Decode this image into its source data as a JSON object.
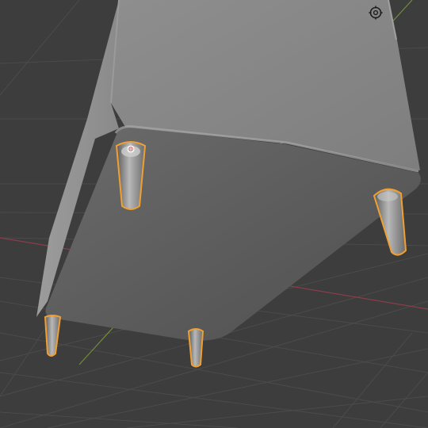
{
  "viewport": {
    "background_color": "#3d3d3d",
    "grid_color": "#4b4b4b",
    "x_axis_color": "#8a3e4a",
    "y_axis_color": "#6f8c3a",
    "selection_outline_color": "#f0a030",
    "mesh_color": "#7a7a7a"
  },
  "objects": {
    "cube": {
      "name_icon": "mesh-object"
    },
    "legs": [
      {
        "selected": true
      },
      {
        "selected": true
      },
      {
        "selected": true
      },
      {
        "selected": true
      }
    ],
    "origin_marker": {
      "icon": "3d-cursor-icon"
    }
  },
  "overlay": {
    "gizmo_icon": "viewport-gizmo-icon"
  }
}
